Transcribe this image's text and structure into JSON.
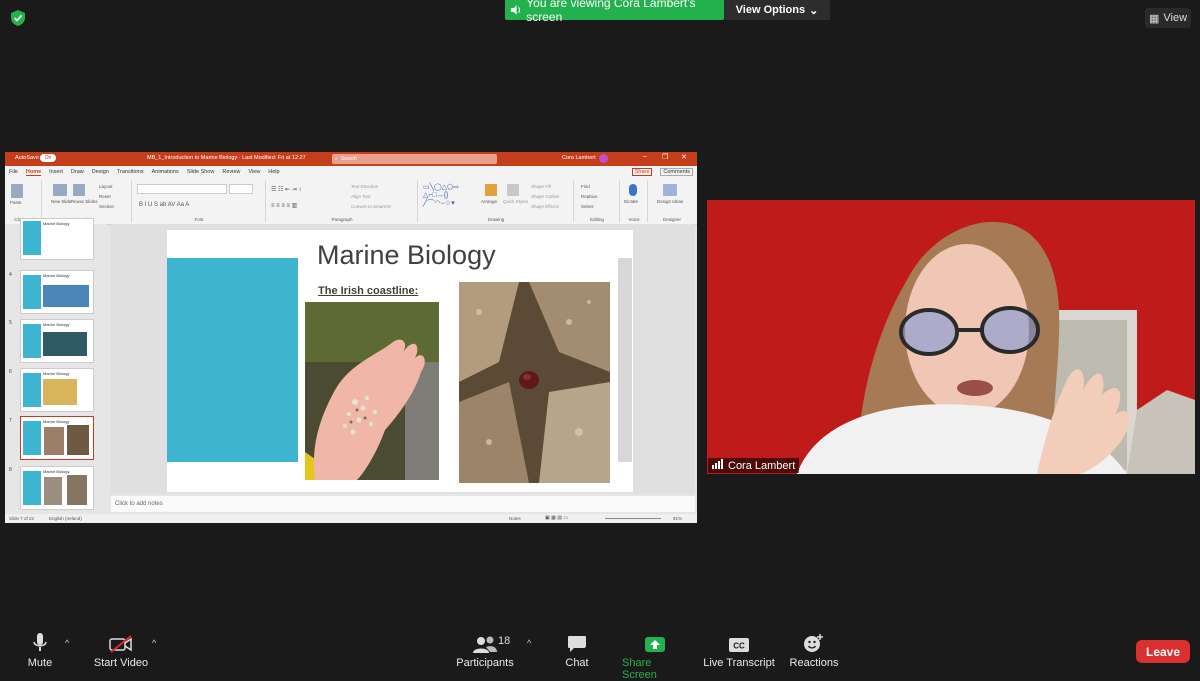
{
  "zoom": {
    "banner_text": "You are viewing Cora Lambert's screen",
    "view_options_label": "View Options",
    "view_button_label": "View",
    "participant_name": "Cora Lambert",
    "toolbar": {
      "mute_label": "Mute",
      "video_label": "Start Video",
      "participants_label": "Participants",
      "participants_count": "18",
      "chat_label": "Chat",
      "share_label": "Share Screen",
      "transcript_label": "Live Transcript",
      "reactions_label": "Reactions",
      "leave_label": "Leave"
    },
    "colors": {
      "share_green": "#23b14d",
      "leave_red": "#d9312f"
    }
  },
  "ppt": {
    "autosave": "AutoSave",
    "autosave_state": "On",
    "file_title": "MB_1_Introduction to Marine Biology  ·  Last Modified: Fri at 12:27",
    "search_placeholder": "Search",
    "user": "Cora Lambert",
    "tabs": [
      "File",
      "Home",
      "Insert",
      "Draw",
      "Design",
      "Transitions",
      "Animations",
      "Slide Show",
      "Review",
      "View",
      "Help"
    ],
    "active_tab": "Home",
    "share_label": "Share",
    "comments_label": "Comments",
    "ribbon_groups": {
      "clipboard": "Clipboard",
      "slides": "Slides",
      "font": "Font",
      "paragraph": "Paragraph",
      "drawing": "Drawing",
      "editing": "Editing",
      "voice": "Voice",
      "designer": "Designer"
    },
    "ribbon_buttons": {
      "paste": "Paste",
      "new_slide": "New Slide",
      "reuse_slides": "Reuse Slides",
      "layout": "Layout",
      "reset": "Reset",
      "section": "Section",
      "text_direction": "Text Direction",
      "align_text": "Align Text",
      "convert_smartart": "Convert to SmartArt",
      "arrange": "Arrange",
      "quick_styles": "Quick Styles",
      "shape_fill": "Shape Fill",
      "shape_outline": "Shape Outline",
      "shape_effects": "Shape Effects",
      "find": "Find",
      "replace": "Replace",
      "select": "Select",
      "dictate": "Dictate",
      "design_ideas": "Design Ideas"
    },
    "thumbnails": [
      {
        "num": "",
        "title": "Marine Biology"
      },
      {
        "num": "4",
        "title": "Marine Biology"
      },
      {
        "num": "5",
        "title": "Marine Biology"
      },
      {
        "num": "6",
        "title": "Marine Biology"
      },
      {
        "num": "7",
        "title": "Marine Biology"
      },
      {
        "num": "8",
        "title": "Marine Biology"
      }
    ],
    "slide": {
      "title": "Marine Biology",
      "subheading": "The Irish coastline:"
    },
    "notes_placeholder": "Click to add notes",
    "status": {
      "slide_pos": "Slide 7 of 22",
      "language": "English (Ireland)",
      "notes_btn": "Notes",
      "zoom": "81%"
    }
  }
}
